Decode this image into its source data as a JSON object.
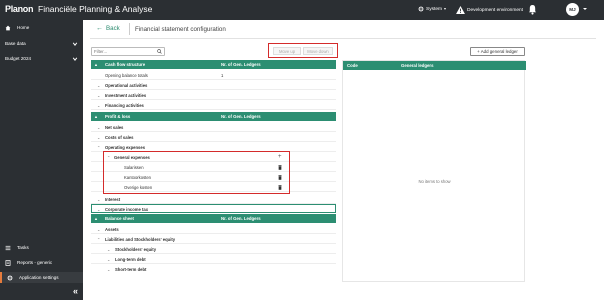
{
  "topbar": {
    "logo": "Planon",
    "app_title": "Financiële Planning & Analyse",
    "system_label": "System",
    "environment_label": "Development environment",
    "user_initials": "MJ"
  },
  "sidebar": {
    "items": [
      {
        "label": "Home"
      },
      {
        "label": "Base data"
      },
      {
        "label": "Budget 2024"
      }
    ],
    "bottom_items": [
      {
        "label": "Tasks"
      },
      {
        "label": "Reports - generic"
      },
      {
        "label": "Application settings"
      }
    ],
    "collapse_glyph": "«"
  },
  "header": {
    "back_label": "Back",
    "page_title": "Financial statement configuration"
  },
  "toolbar": {
    "filter_placeholder": "Filter...",
    "move_up_label": "Move up",
    "move_down_label": "Move down",
    "add_ledger_label": "+ Add general ledger"
  },
  "tree": {
    "col_count_label": "Nr. of Gen. Ledgers",
    "cash_flow": {
      "title": "Cash flow structure",
      "rows": [
        {
          "label": "Opening balance totals",
          "count": "1"
        },
        {
          "label": "Operational activities",
          "count": ""
        },
        {
          "label": "Investment activities",
          "count": ""
        },
        {
          "label": "Financing activities",
          "count": ""
        }
      ]
    },
    "profit_loss": {
      "title": "Profit & loss",
      "rows": [
        {
          "label": "Net sales"
        },
        {
          "label": "Costs of sales"
        },
        {
          "label": "Operating expenses"
        },
        {
          "label": "General expenses"
        },
        {
          "label": "Salarissen"
        },
        {
          "label": "Kantoorkosten"
        },
        {
          "label": "Overige kosten"
        },
        {
          "label": "Interest"
        },
        {
          "label": "Corporate income tax"
        }
      ]
    },
    "balance_sheet": {
      "title": "Balance sheet",
      "rows": [
        {
          "label": "Assets"
        },
        {
          "label": "Liabilities and Stockholders' equity"
        },
        {
          "label": "Stockholders' equity"
        },
        {
          "label": "Long-term debt"
        },
        {
          "label": "Short-term debt"
        }
      ]
    }
  },
  "right_panel": {
    "col_code": "Code",
    "col_ledgers": "General ledgers",
    "empty_message": "No items to show"
  },
  "colors": {
    "accent_green": "#2c8e72",
    "dark_bar": "#2b2f33",
    "highlight_red": "#d42b2b"
  }
}
